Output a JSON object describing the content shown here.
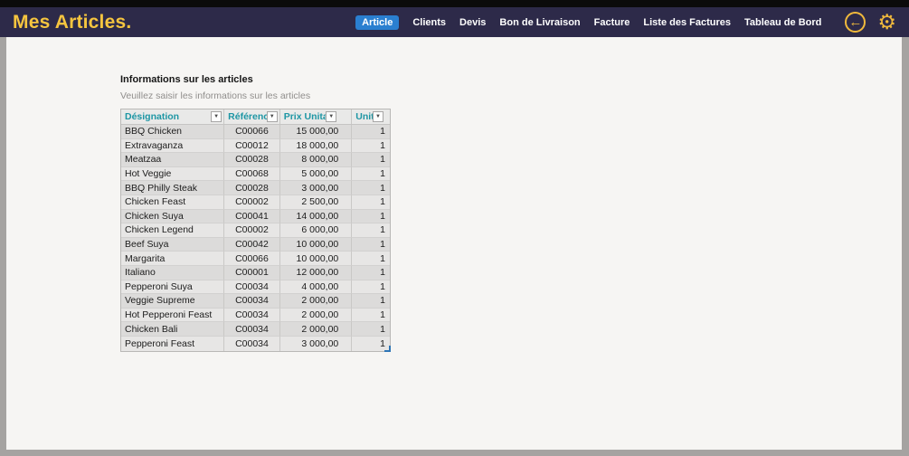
{
  "header": {
    "title": "Mes Articles.",
    "nav": [
      {
        "label": "Article",
        "active": true
      },
      {
        "label": "Clients",
        "active": false
      },
      {
        "label": "Devis",
        "active": false
      },
      {
        "label": "Bon de Livraison",
        "active": false
      },
      {
        "label": "Facture",
        "active": false
      },
      {
        "label": "Liste des Factures",
        "active": false
      },
      {
        "label": "Tableau de Bord",
        "active": false
      }
    ],
    "icons": {
      "back_arrow": "←",
      "gear": "⚙"
    }
  },
  "content": {
    "heading": "Informations sur les articles",
    "subheading": "Veuillez saisir les informations sur les articles"
  },
  "table": {
    "columns": [
      "Désignation",
      "Référence",
      "Prix Unitaire",
      "Unité"
    ],
    "filter_glyph": "▼",
    "rows": [
      [
        "BBQ Chicken",
        "C00066",
        "15 000,00",
        "1"
      ],
      [
        "Extravaganza",
        "C00012",
        "18 000,00",
        "1"
      ],
      [
        "Meatzaa",
        "C00028",
        "8 000,00",
        "1"
      ],
      [
        "Hot Veggie",
        "C00068",
        "5 000,00",
        "1"
      ],
      [
        "BBQ Philly Steak",
        "C00028",
        "3 000,00",
        "1"
      ],
      [
        "Chicken Feast",
        "C00002",
        "2 500,00",
        "1"
      ],
      [
        "Chicken Suya",
        "C00041",
        "14 000,00",
        "1"
      ],
      [
        "Chicken Legend",
        "C00002",
        "6 000,00",
        "1"
      ],
      [
        "Beef Suya",
        "C00042",
        "10 000,00",
        "1"
      ],
      [
        "Margarita",
        "C00066",
        "10 000,00",
        "1"
      ],
      [
        "Italiano",
        "C00001",
        "12 000,00",
        "1"
      ],
      [
        "Pepperoni Suya",
        "C00034",
        "4 000,00",
        "1"
      ],
      [
        "Veggie Supreme",
        "C00034",
        "2 000,00",
        "1"
      ],
      [
        "Hot Pepperoni Feast",
        "C00034",
        "2 000,00",
        "1"
      ],
      [
        "Chicken Bali",
        "C00034",
        "2 000,00",
        "1"
      ],
      [
        "Pepperoni Feast",
        "C00034",
        "3 000,00",
        "1"
      ]
    ]
  },
  "colors": {
    "header_bg": "#2d2a49",
    "title_gold": "#f6c53f",
    "active_nav_blue": "#2a7fd0",
    "table_header_teal": "#1d96a4",
    "content_bg": "#f6f5f3"
  }
}
